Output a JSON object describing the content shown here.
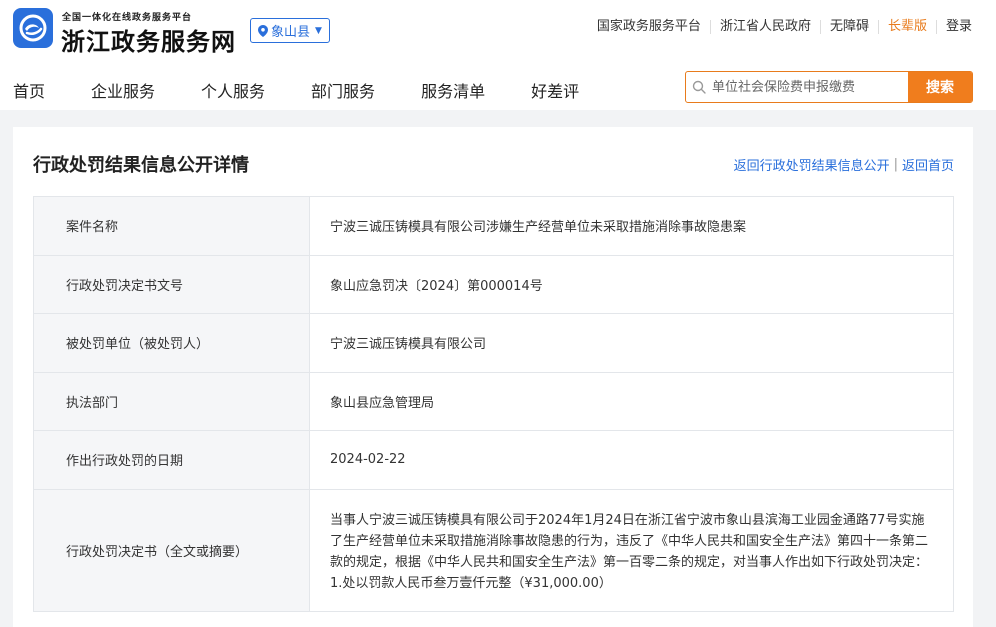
{
  "header": {
    "brand_sub": "全国一体化在线政务服务平台",
    "brand_title": "浙江政务服务网",
    "region": "象山县",
    "top_links": [
      "国家政务服务平台",
      "浙江省人民政府",
      "无障碍",
      "长辈版",
      "登录"
    ],
    "nav": [
      "首页",
      "企业服务",
      "个人服务",
      "部门服务",
      "服务清单",
      "好差评"
    ],
    "search": {
      "placeholder": "单位社会保险费申报缴费",
      "button": "搜索"
    }
  },
  "colors": {
    "accent_blue": "#2a6fdb",
    "accent_orange": "#f07d1d"
  },
  "detail": {
    "title": "行政处罚结果信息公开详情",
    "back_list": "返回行政处罚结果信息公开",
    "sep": "|",
    "back_home": "返回首页",
    "rows": [
      {
        "label": "案件名称",
        "value": "宁波三诚压铸模具有限公司涉嫌生产经营单位未采取措施消除事故隐患案"
      },
      {
        "label": "行政处罚决定书文号",
        "value": "象山应急罚决〔2024〕第000014号"
      },
      {
        "label": "被处罚单位（被处罚人）",
        "value": "宁波三诚压铸模具有限公司"
      },
      {
        "label": "执法部门",
        "value": "象山县应急管理局"
      },
      {
        "label": "作出行政处罚的日期",
        "value": "2024-02-22"
      },
      {
        "label": "行政处罚决定书（全文或摘要）",
        "value": "当事人宁波三诚压铸模具有限公司于2024年1月24日在浙江省宁波市象山县滨海工业园金通路77号实施了生产经营单位未采取措施消除事故隐患的行为，违反了《中华人民共和国安全生产法》第四十一条第二款的规定，根据《中华人民共和国安全生产法》第一百零二条的规定，对当事人作出如下行政处罚决定：1.处以罚款人民币叁万壹仟元整（¥31,000.00）"
      }
    ]
  }
}
